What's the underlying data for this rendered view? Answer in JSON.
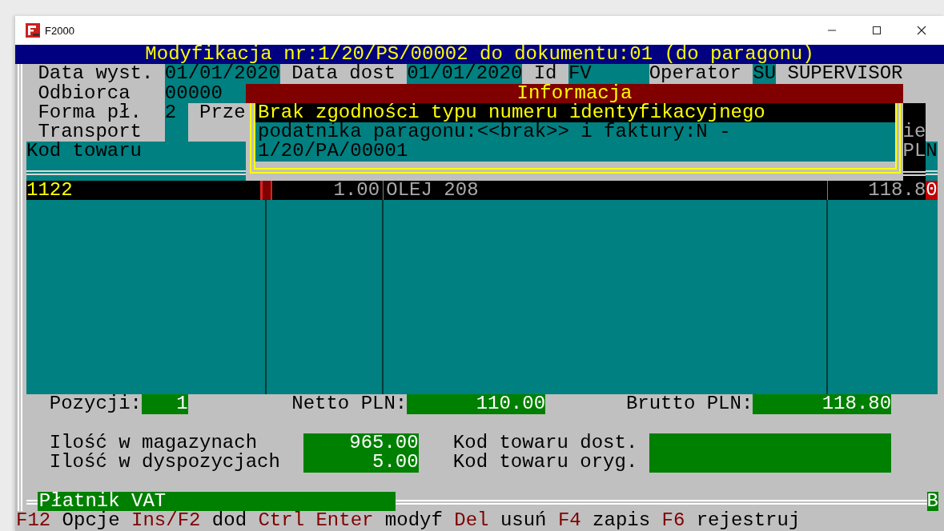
{
  "window": {
    "title": "F2000"
  },
  "header_title": "Modyfikacja nr:1/20/PS/00002 do dokumentu:01 (do paragonu)",
  "form": {
    "data_wyst": {
      "label": "Data wyst.",
      "value": "01/01/2020"
    },
    "data_dost": {
      "label": "Data dost",
      "value": "01/01/2020"
    },
    "id": {
      "label": "Id",
      "value": "FV"
    },
    "operator": {
      "label": "Operator",
      "code": "SU",
      "name": "SUPERVISOR"
    },
    "odbiorca": {
      "label": "Odbiorca",
      "value": "00000"
    },
    "forma_pl": {
      "label": "Forma pł.",
      "value": "2"
    },
    "prze": {
      "label": "Prze"
    },
    "transport": {
      "label": "Transport"
    }
  },
  "table": {
    "headers": {
      "column_1": "Kod towaru",
      "last_line_1": "ie",
      "last_line_2": "PL",
      "extra": "N"
    },
    "rows": [
      {
        "kod": "1122",
        "ilosc": "1.00",
        "nazwa": "OLEJ 208",
        "cena": "118.8",
        "extra": "0",
        "selected": true
      }
    ]
  },
  "summary": [
    {
      "label": "Pozycji:",
      "value": "1"
    },
    {
      "label": "Netto PLN:",
      "value": "110.00"
    },
    {
      "label": "Brutto PLN:",
      "value": "118.80"
    }
  ],
  "stock": [
    {
      "label": "Ilość w magazynach",
      "value": "965.00"
    },
    {
      "label": "Ilość w dyspozycjach",
      "value": "5.00"
    }
  ],
  "codes": [
    {
      "label": "Kod towaru dost."
    },
    {
      "label": "Kod towaru oryg."
    }
  ],
  "status": {
    "platnik": "Płatnik VAT",
    "indicator": "B"
  },
  "shortcuts": [
    {
      "key": "F12",
      "label": "Opcje"
    },
    {
      "key": "Ins/F2",
      "label": "dod"
    },
    {
      "key": "Ctrl Enter",
      "label": "modyf"
    },
    {
      "key": "Del",
      "label": "usuń"
    },
    {
      "key": "F4",
      "label": "zapis"
    },
    {
      "key": "F6",
      "label": "rejestruj"
    }
  ],
  "dialog": {
    "title": "Informacja",
    "lines": [
      {
        "text": "Brak zgodności typu numeru identyfikacyjnego",
        "highlighted": true
      },
      {
        "text": "podatnika paragonu:<<brak>> i faktury:N -",
        "highlighted": false
      },
      {
        "text": "1/20/PA/00001",
        "highlighted": false
      }
    ]
  }
}
